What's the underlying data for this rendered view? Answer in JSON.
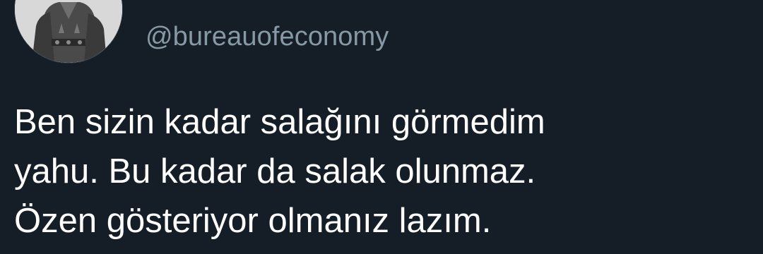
{
  "tweet": {
    "handle": "@bureauofeconomy",
    "text_lines": [
      "Ben sizin kadar salağını görmedim",
      "yahu. Bu kadar da salak olunmaz.",
      "Özen gösteriyor olmanız lazım."
    ]
  },
  "colors": {
    "background": "#151e27",
    "text": "#ffffff",
    "handle": "#8899a6"
  }
}
